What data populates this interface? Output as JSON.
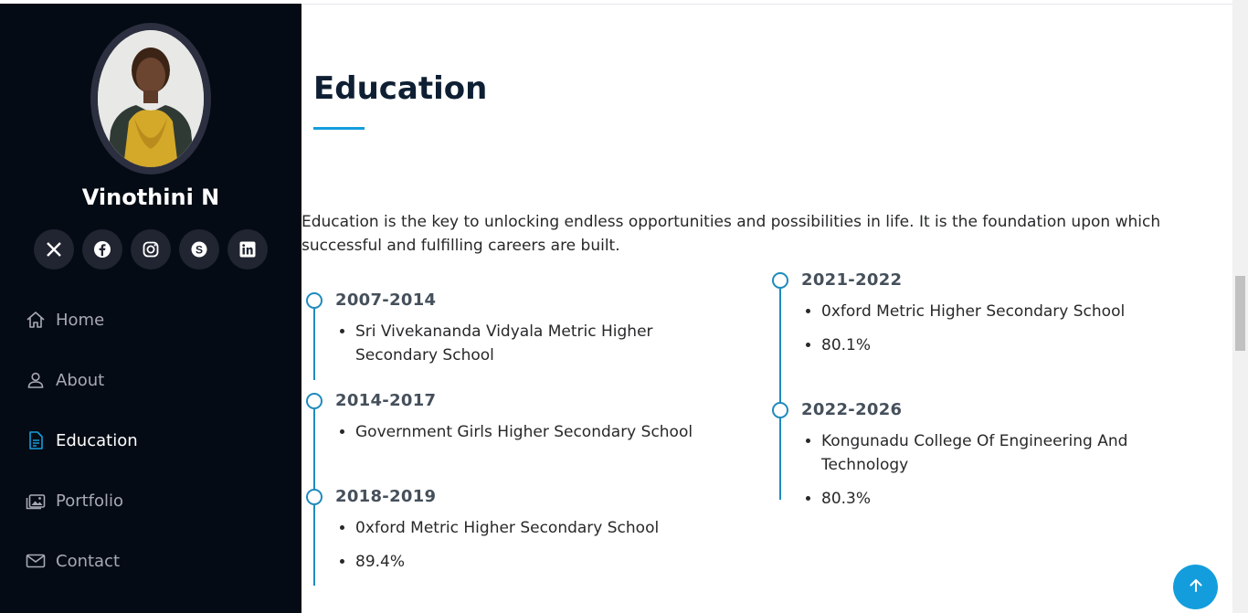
{
  "profile": {
    "name": "Vinothini N"
  },
  "social": [
    "x-twitter-icon",
    "facebook-icon",
    "instagram-icon",
    "skype-icon",
    "linkedin-icon"
  ],
  "nav": {
    "items": [
      {
        "label": "Home",
        "icon": "home-icon",
        "active": false
      },
      {
        "label": "About",
        "icon": "person-icon",
        "active": false
      },
      {
        "label": "Education",
        "icon": "document-icon",
        "active": true
      },
      {
        "label": "Portfolio",
        "icon": "images-icon",
        "active": false
      },
      {
        "label": "Contact",
        "icon": "envelope-icon",
        "active": false
      }
    ]
  },
  "section": {
    "title": "Education",
    "intro": "Education is the key to unlocking endless opportunities and possibilities in life. It is the foundation upon which successful and fulfilling careers are built."
  },
  "education": [
    {
      "year": "2007-2014",
      "items": [
        "Sri Vivekananda Vidyala Metric Higher Secondary School"
      ]
    },
    {
      "year": "2014-2017",
      "items": [
        "Government Girls Higher Secondary School"
      ]
    },
    {
      "year": "2018-2019",
      "items": [
        "0xford Metric Higher Secondary School",
        "89.4%"
      ]
    },
    {
      "year": "2021-2022",
      "items": [
        "0xford Metric Higher Secondary School",
        "80.1%"
      ]
    },
    {
      "year": "2022-2026",
      "items": [
        "Kongunadu College Of Engineering And Technology",
        "80.3%"
      ]
    }
  ],
  "colors": {
    "accent": "#149ddd",
    "sidebar_bg": "#040b14",
    "timeline": "#1f8bbd"
  },
  "back_to_top": {
    "icon": "arrow-up-icon"
  }
}
